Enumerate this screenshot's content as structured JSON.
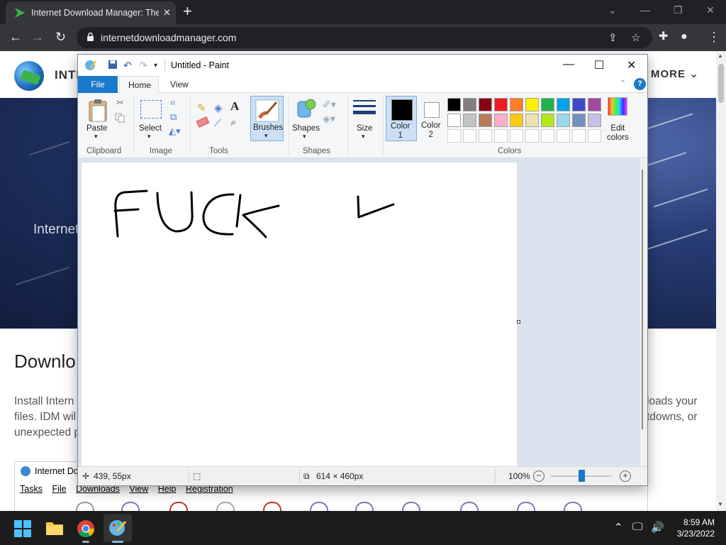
{
  "browser": {
    "tab_title": "Internet Download Manager: The",
    "url": "internetdownloadmanager.com"
  },
  "site": {
    "brand": "INTE",
    "more": "MORE",
    "hero_text": "Internet",
    "heading": "Downlo",
    "para_left": [
      "Install Intern",
      "files. IDM wil",
      "unexpected p"
    ],
    "para_right": [
      "loads your",
      "tdowns, or"
    ]
  },
  "idm": {
    "title": "Internet Dov",
    "menu": [
      "Tasks",
      "File",
      "Downloads",
      "View",
      "Help",
      "Registration"
    ]
  },
  "paint": {
    "title": "Untitled - Paint",
    "tabs": {
      "file": "File",
      "home": "Home",
      "view": "View"
    },
    "ribbon": {
      "paste": "Paste",
      "select": "Select",
      "brushes": "Brushes",
      "shapes": "Shapes",
      "size": "Size",
      "color1": [
        "Color",
        "1"
      ],
      "color2": [
        "Color",
        "2"
      ],
      "edit_colors": [
        "Edit",
        "colors"
      ],
      "groups": [
        "Clipboard",
        "Image",
        "Tools",
        "Shapes",
        "Colors"
      ]
    },
    "palette_row1": [
      "#000000",
      "#7f7f7f",
      "#880015",
      "#ed1c24",
      "#ff7f27",
      "#fff200",
      "#22b14c",
      "#00a2e8",
      "#3f48cc",
      "#a349a4"
    ],
    "palette_row2": [
      "#ffffff",
      "#c3c3c3",
      "#b97a57",
      "#ffaec9",
      "#ffc90e",
      "#efe4b0",
      "#b5e61d",
      "#99d9ea",
      "#7092be",
      "#c8bfe7"
    ],
    "color1_value": "#000000",
    "color2_value": "#ffffff",
    "canvas_text": "FUCK",
    "status": {
      "cursor": "439, 55px",
      "size": "614 × 460px",
      "zoom": "100%"
    }
  },
  "taskbar": {
    "time": "8:59 AM",
    "date": "3/23/2022"
  }
}
